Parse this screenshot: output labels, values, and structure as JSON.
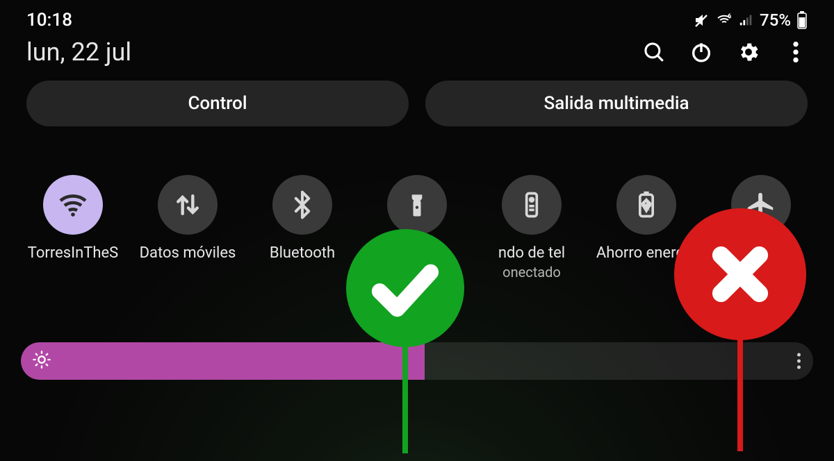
{
  "status": {
    "time": "10:18",
    "battery_pct": "75%"
  },
  "header": {
    "date": "lun, 22 jul"
  },
  "pills": {
    "control": "Control",
    "media": "Salida multimedia"
  },
  "tiles": [
    {
      "id": "wifi",
      "label": "TorresInTheS",
      "active": true
    },
    {
      "id": "mobiledata",
      "label": "Datos móviles",
      "active": false
    },
    {
      "id": "bluetooth",
      "label": "Bluetooth",
      "active": false
    },
    {
      "id": "flashlight",
      "label": "",
      "active": false
    },
    {
      "id": "remote",
      "label": "ndo de tel",
      "sub": "onectado",
      "active": false
    },
    {
      "id": "battery",
      "label": "Ahorro energía",
      "active": false
    },
    {
      "id": "airplane",
      "label": "",
      "active": false
    }
  ],
  "brightness": {
    "percent": 51
  },
  "overlay": {
    "ok_color": "#12a321",
    "no_color": "#d81a1a"
  }
}
